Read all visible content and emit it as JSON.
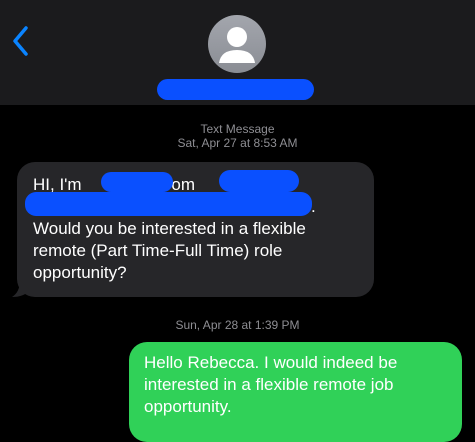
{
  "header": {
    "back_icon": "chevron-left-icon",
    "avatar_icon": "person-silhouette-icon",
    "accent_color": "#0a84ff"
  },
  "thread": {
    "service_label": "Text Message",
    "first_timestamp": "Sat, Apr 27 at 8:53 AM",
    "second_timestamp": "Sun, Apr 28 at 1:39 PM"
  },
  "incoming": {
    "line1_prefix": "HI, I'm",
    "line1_mid": "from",
    "line1_suffix": "",
    "line2_end": ".",
    "line3": "Would you be interested in a flexible",
    "line4": "remote (Part Time-Full Time) role",
    "line5": "opportunity?"
  },
  "outgoing": {
    "line1": "Hello Rebecca. I would indeed be",
    "line2": "interested in a flexible remote job",
    "line3": "opportunity."
  },
  "colors": {
    "incoming_bubble": "#262629",
    "outgoing_bubble": "#30d158",
    "redaction": "#0a50ff"
  }
}
